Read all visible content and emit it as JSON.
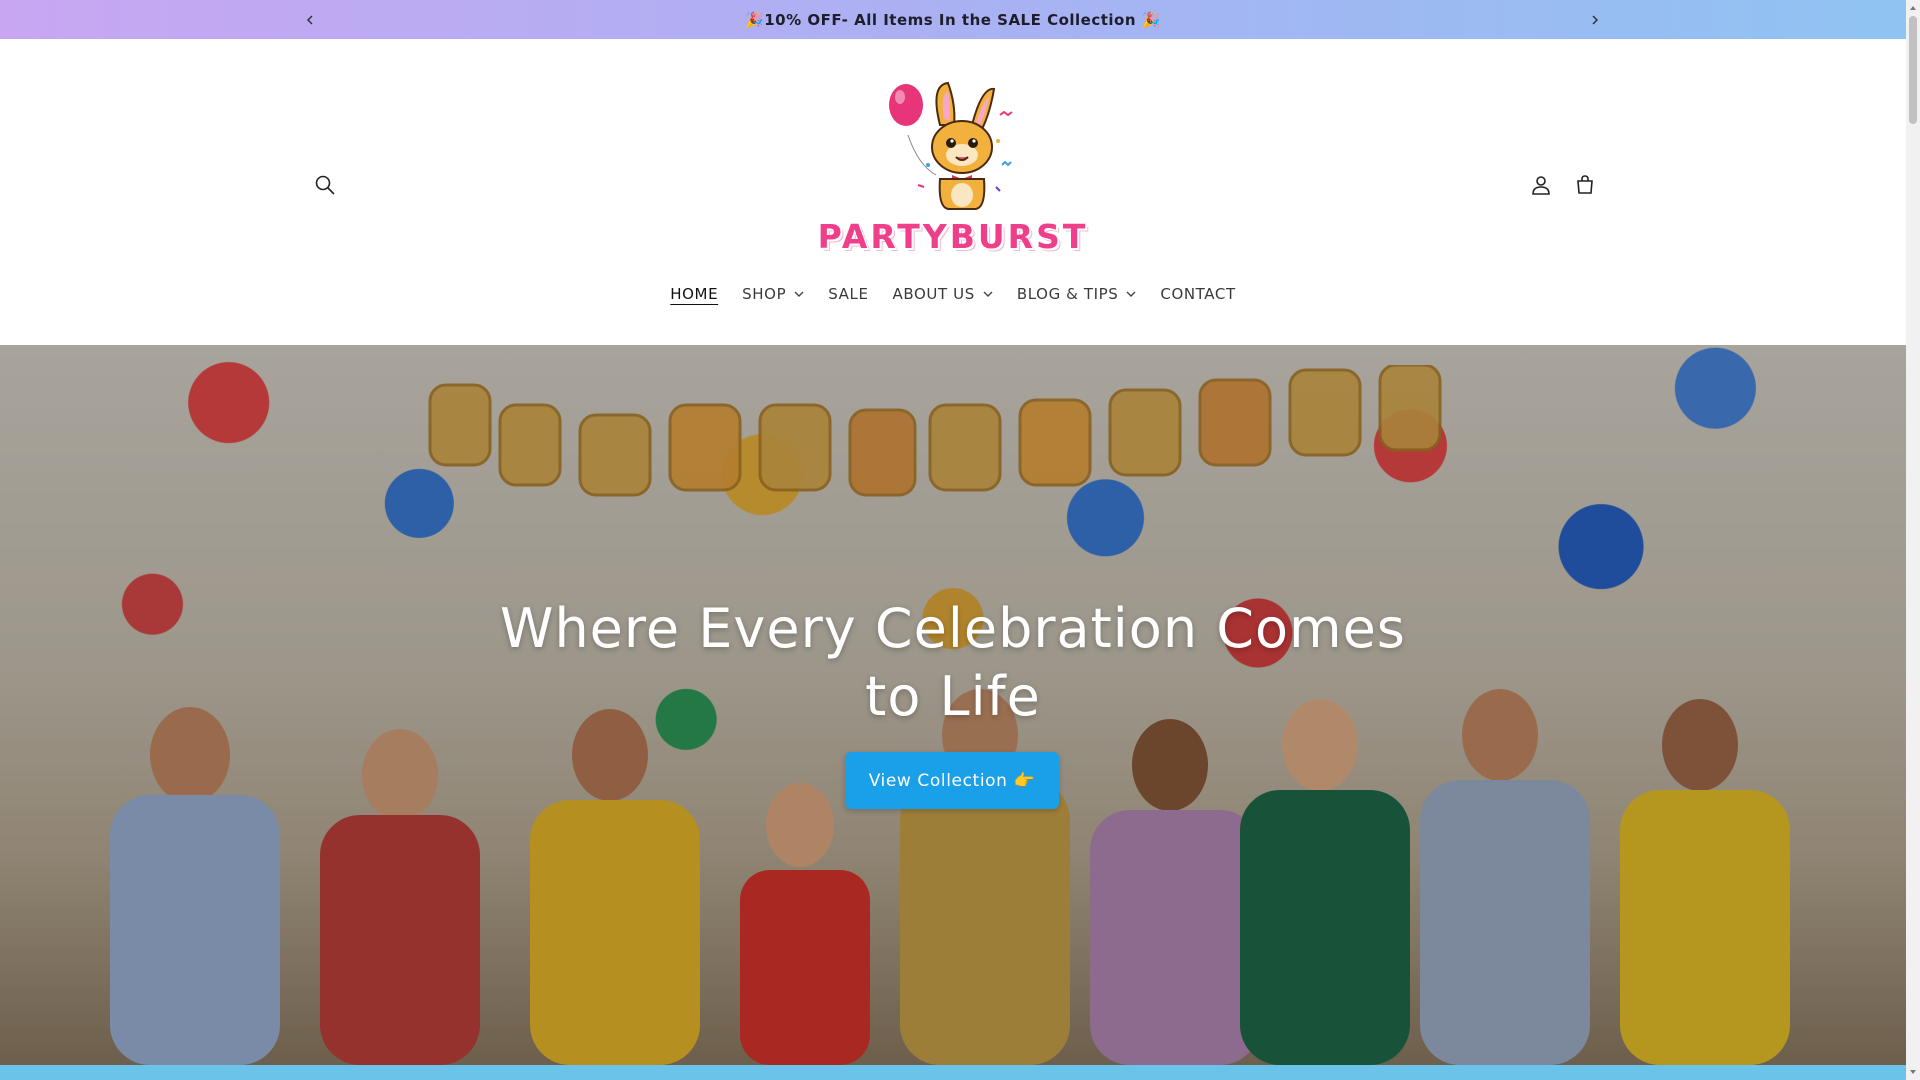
{
  "announcement": {
    "text": "🎉10% OFF- All Items In the SALE Collection 🎉",
    "prev_icon": "chevron-left-icon",
    "next_icon": "chevron-right-icon"
  },
  "header": {
    "logo_text": "PARTYBURST",
    "icons": [
      "search-icon",
      "account-icon",
      "cart-icon"
    ]
  },
  "nav": {
    "items": [
      {
        "label": "HOME",
        "active": true,
        "dropdown": false
      },
      {
        "label": "SHOP",
        "active": false,
        "dropdown": true
      },
      {
        "label": "SALE",
        "active": false,
        "dropdown": false
      },
      {
        "label": "ABOUT US",
        "active": false,
        "dropdown": true
      },
      {
        "label": "BLOG & TIPS",
        "active": false,
        "dropdown": true
      },
      {
        "label": "CONTACT",
        "active": false,
        "dropdown": false
      }
    ]
  },
  "hero": {
    "title_line1": "Where Every Celebration Comes",
    "title_line2": "to Life",
    "cta_label": "View Collection 👉"
  },
  "colors": {
    "accent": "#1aa0e8",
    "brand_pink": "#ef3f8a",
    "announce_gradient_start": "#c8a6f2",
    "announce_gradient_end": "#8fc3f2"
  }
}
